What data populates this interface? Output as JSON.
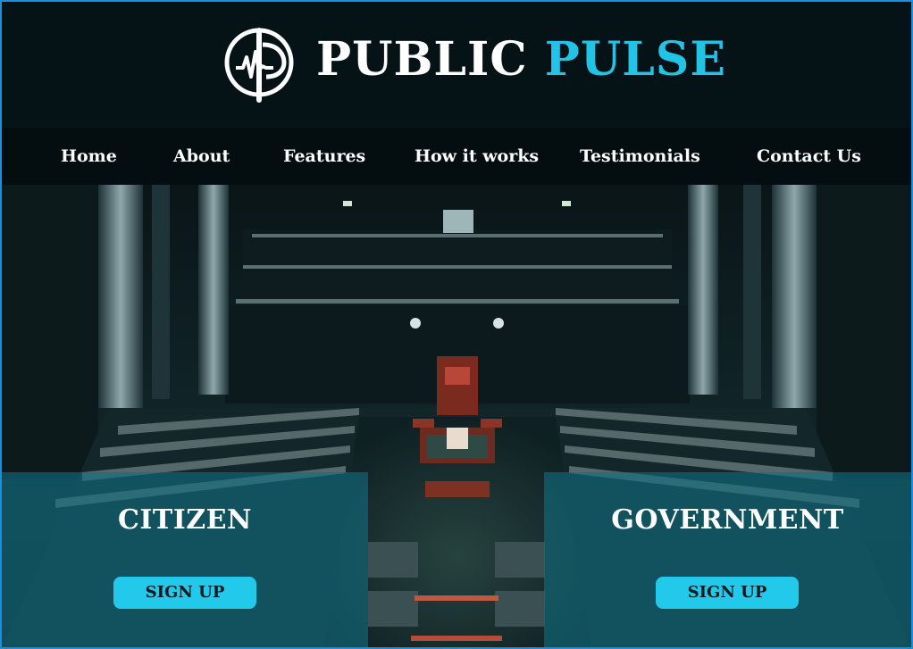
{
  "brand": {
    "name_part1": "PUBLIC",
    "name_part2": "PULSE",
    "accent_color": "#22c3e6"
  },
  "nav": {
    "items": [
      {
        "label": "Home"
      },
      {
        "label": "About"
      },
      {
        "label": "Features"
      },
      {
        "label": "How it works"
      },
      {
        "label": "Testimonials"
      },
      {
        "label": "Contact Us"
      }
    ]
  },
  "hero": {
    "background": "parliament-chamber-photo",
    "citizen": {
      "title": "CITIZEN",
      "button_label": "SIGN UP"
    },
    "government": {
      "title": "GOVERNMENT",
      "button_label": "SIGN UP"
    }
  },
  "icons": {
    "logo": "pulse-compass-logo-icon"
  }
}
